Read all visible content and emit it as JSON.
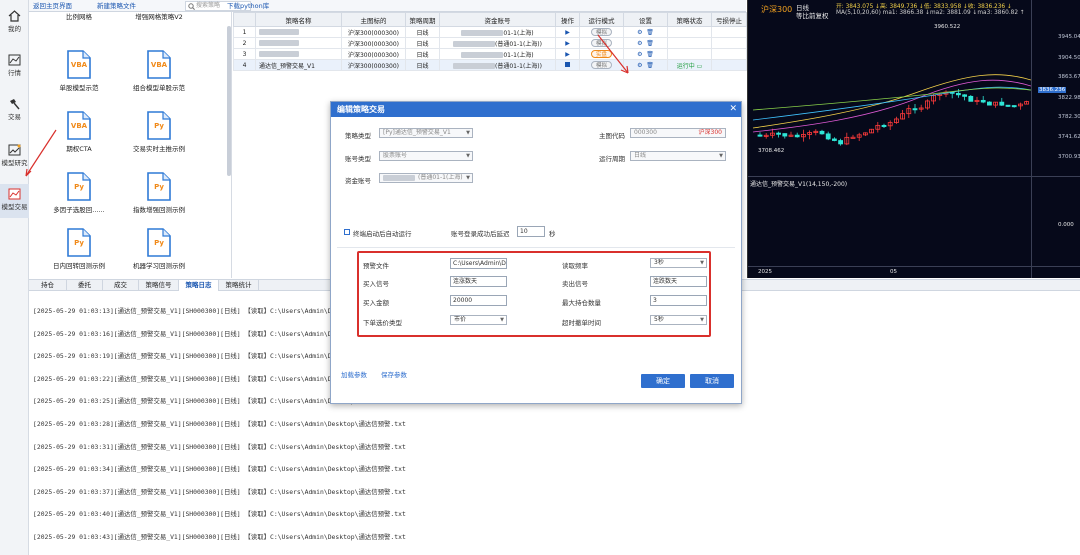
{
  "nav": [
    {
      "label": "我的",
      "icon": "home-icon"
    },
    {
      "label": "行情",
      "icon": "market-chart-icon"
    },
    {
      "label": "交易",
      "icon": "trade-hammer-icon"
    },
    {
      "label": "模型研究",
      "icon": "model-research-icon"
    },
    {
      "label": "模型交易",
      "icon": "model-trade-icon"
    }
  ],
  "toolbar": {
    "back_home": "返回主页界面",
    "new_strategy": "新建策略文件",
    "search_placeholder": "搜索策略",
    "download_python": "下载python库"
  },
  "templates": [
    {
      "tag": "",
      "name": "比例网格"
    },
    {
      "tag": "",
      "name": "增强网格策略V2"
    },
    {
      "tag": "VBA",
      "name": "单股模型示范"
    },
    {
      "tag": "VBA",
      "name": "组合模型单股示范"
    },
    {
      "tag": "VBA",
      "name": "期权CTA"
    },
    {
      "tag": "Py",
      "name": "交易实时主推示例"
    },
    {
      "tag": "Py",
      "name": "多因子选股回......"
    },
    {
      "tag": "Py",
      "name": "指数增强回测示例"
    },
    {
      "tag": "Py",
      "name": "日内回转回测示例"
    },
    {
      "tag": "Py",
      "name": "机器学习回测示例"
    }
  ],
  "strategy_table": {
    "headers": [
      "",
      "策略名称",
      "主图标的",
      "策略周期",
      "资金账号",
      "操作",
      "运行模式",
      "设置",
      "策略状态",
      "亏损停止"
    ],
    "rows": [
      {
        "idx": "1",
        "name": "",
        "symbol": "沪深300(000300)",
        "period": "日线",
        "account": "01-1(上海)",
        "mode": "模拟",
        "status": ""
      },
      {
        "idx": "2",
        "name": "",
        "symbol": "沪深300(000300)",
        "period": "日线",
        "account": "(普通01-1(上海))",
        "mode": "模拟",
        "status": ""
      },
      {
        "idx": "3",
        "name": "",
        "symbol": "沪深300(000300)",
        "period": "日线",
        "account": "01-1(上海)",
        "mode": "实盘",
        "status": ""
      },
      {
        "idx": "4",
        "name": "通达信_预警交易_V1",
        "symbol": "沪深300(000300)",
        "period": "日线",
        "account": "(普通01-1(上海))",
        "mode": "模拟",
        "status": "运行中"
      }
    ]
  },
  "chart": {
    "name": "沪深300",
    "period": "日线",
    "adjust": "等比前复权",
    "ohlc": "开: 3843.075 ↓高: 3849.736 ↓低: 3833.958 ↓收: 3836.236 ↓",
    "ma": "MA(5,10,20,60)  ma1: 3866.38  ↓ma2: 3881.09  ↓ma3: 3860.82  ↑",
    "high_mark": "3960.522",
    "low_mark": "3708.462",
    "y_ticks": [
      "3945.04",
      "3904.50",
      "3863.67",
      "3822.98",
      "3782.30",
      "3741.62",
      "3700.93"
    ],
    "current_price": "3836.236",
    "indicator_label": "通达信_预警交易_V1(14,150,-200)",
    "indicator_tick": "0.000",
    "x_ticks": [
      "2025",
      "05"
    ],
    "colors": {
      "up": "#ff3b3b",
      "down": "#2ee6d6",
      "bg": "#06091a"
    }
  },
  "bottom_tabs": [
    "持仓",
    "委托",
    "成交",
    "策略信号",
    "策略日志",
    "策略统计"
  ],
  "active_tab": "策略日志",
  "log_lines": [
    "[2025-05-29 01:03:13][通达信_预警交易_V1][SH000300][日线] 【读取】C:\\Users\\Admin\\Desktop\\",
    "[2025-05-29 01:03:16][通达信_预警交易_V1][SH000300][日线] 【读取】C:\\Users\\Admin\\Desktop\\",
    "[2025-05-29 01:03:19][通达信_预警交易_V1][SH000300][日线] 【读取】C:\\Users\\Admin\\Desktop\\",
    "[2025-05-29 01:03:22][通达信_预警交易_V1][SH000300][日线] 【读取】C:\\Users\\Admin\\Desktop\\",
    "[2025-05-29 01:03:25][通达信_预警交易_V1][SH000300][日线] 【读取】C:\\Users\\Admin\\Desktop\\",
    "[2025-05-29 01:03:28][通达信_预警交易_V1][SH000300][日线] 【读取】C:\\Users\\Admin\\Desktop\\通达信预警.txt",
    "[2025-05-29 01:03:31][通达信_预警交易_V1][SH000300][日线] 【读取】C:\\Users\\Admin\\Desktop\\通达信预警.txt",
    "[2025-05-29 01:03:34][通达信_预警交易_V1][SH000300][日线] 【读取】C:\\Users\\Admin\\Desktop\\通达信预警.txt",
    "[2025-05-29 01:03:37][通达信_预警交易_V1][SH000300][日线] 【读取】C:\\Users\\Admin\\Desktop\\通达信预警.txt",
    "[2025-05-29 01:03:40][通达信_预警交易_V1][SH000300][日线] 【读取】C:\\Users\\Admin\\Desktop\\通达信预警.txt",
    "[2025-05-29 01:03:43][通达信_预警交易_V1][SH000300][日线] 【读取】C:\\Users\\Admin\\Desktop\\通达信预警.txt"
  ],
  "modal": {
    "title": "编辑策略交易",
    "strategy_type_label": "策略类型",
    "strategy_type_value": "[Py]通达信_预警交易_V1",
    "main_code_label": "主图代码",
    "main_code_value": "000300",
    "main_code_name": "沪深300",
    "account_type_label": "账号类型",
    "account_type_value": "股票账号",
    "run_period_label": "运行周期",
    "run_period_value": "日线",
    "fund_account_label": "资金账号",
    "fund_account_value": "(普通01-1(上海)",
    "auto_run_label": "终端启动后自动运行",
    "login_delay_label": "账号登录成功后延迟",
    "login_delay_value": "10",
    "login_delay_unit": "秒",
    "params": {
      "alert_file_label": "预警文件",
      "alert_file_value": "C:\\Users\\Admin\\D",
      "read_freq_label": "读取频率",
      "read_freq_value": "3秒",
      "buy_signal_label": "买入信号",
      "buy_signal_value": "连涨数天",
      "sell_signal_label": "卖出信号",
      "sell_signal_value": "连跌数天",
      "buy_amount_label": "买入金额",
      "buy_amount_value": "20000",
      "max_hold_label": "最大持仓数量",
      "max_hold_value": "3",
      "order_price_label": "下单选价类型",
      "order_price_value": "市价",
      "timeout_label": "超时撤单时间",
      "timeout_value": "5秒"
    },
    "load_params": "加载参数",
    "save_params": "保存参数",
    "confirm": "确定",
    "cancel": "取消"
  }
}
